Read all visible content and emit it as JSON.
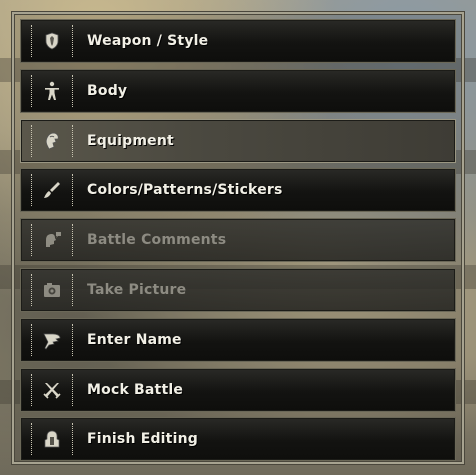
{
  "colors": {
    "label_enabled": "#f2f0e6",
    "label_disabled": "#8d8b82",
    "panel_border": "#a7a390",
    "item_dark": "#131311",
    "item_selected": "#4b4940"
  },
  "menu": {
    "items": [
      {
        "label": "Weapon / Style",
        "icon": "shield-sword-icon",
        "state": "enabled"
      },
      {
        "label": "Body",
        "icon": "body-figure-icon",
        "state": "enabled"
      },
      {
        "label": "Equipment",
        "icon": "helmet-icon",
        "state": "selected"
      },
      {
        "label": "Colors/Patterns/Stickers",
        "icon": "paintbrush-icon",
        "state": "enabled"
      },
      {
        "label": "Battle Comments",
        "icon": "speech-head-icon",
        "state": "disabled"
      },
      {
        "label": "Take Picture",
        "icon": "camera-icon",
        "state": "disabled"
      },
      {
        "label": "Enter Name",
        "icon": "quill-icon",
        "state": "enabled"
      },
      {
        "label": "Mock Battle",
        "icon": "crossed-swords-icon",
        "state": "enabled"
      },
      {
        "label": "Finish Editing",
        "icon": "finish-figure-icon",
        "state": "enabled"
      }
    ]
  }
}
